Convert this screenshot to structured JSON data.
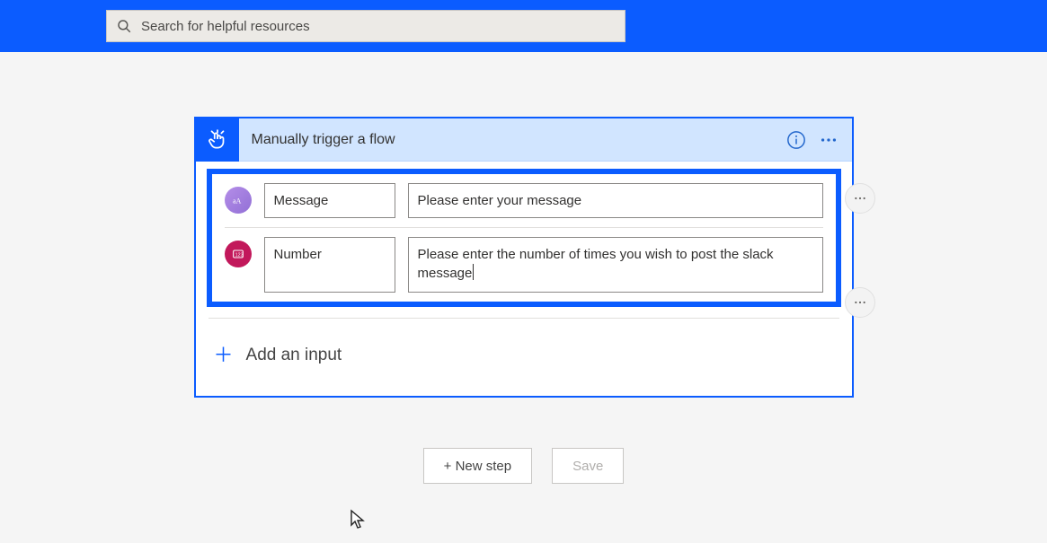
{
  "search": {
    "placeholder": "Search for helpful resources"
  },
  "trigger": {
    "title": "Manually trigger a flow",
    "inputs": [
      {
        "name": "Message",
        "description": "Please enter your message",
        "type": "text"
      },
      {
        "name": "Number",
        "description": "Please enter the number of times you wish to post the slack message",
        "type": "number"
      }
    ],
    "add_input_label": "Add an input"
  },
  "footer": {
    "new_step_label": "+ New step",
    "save_label": "Save"
  }
}
